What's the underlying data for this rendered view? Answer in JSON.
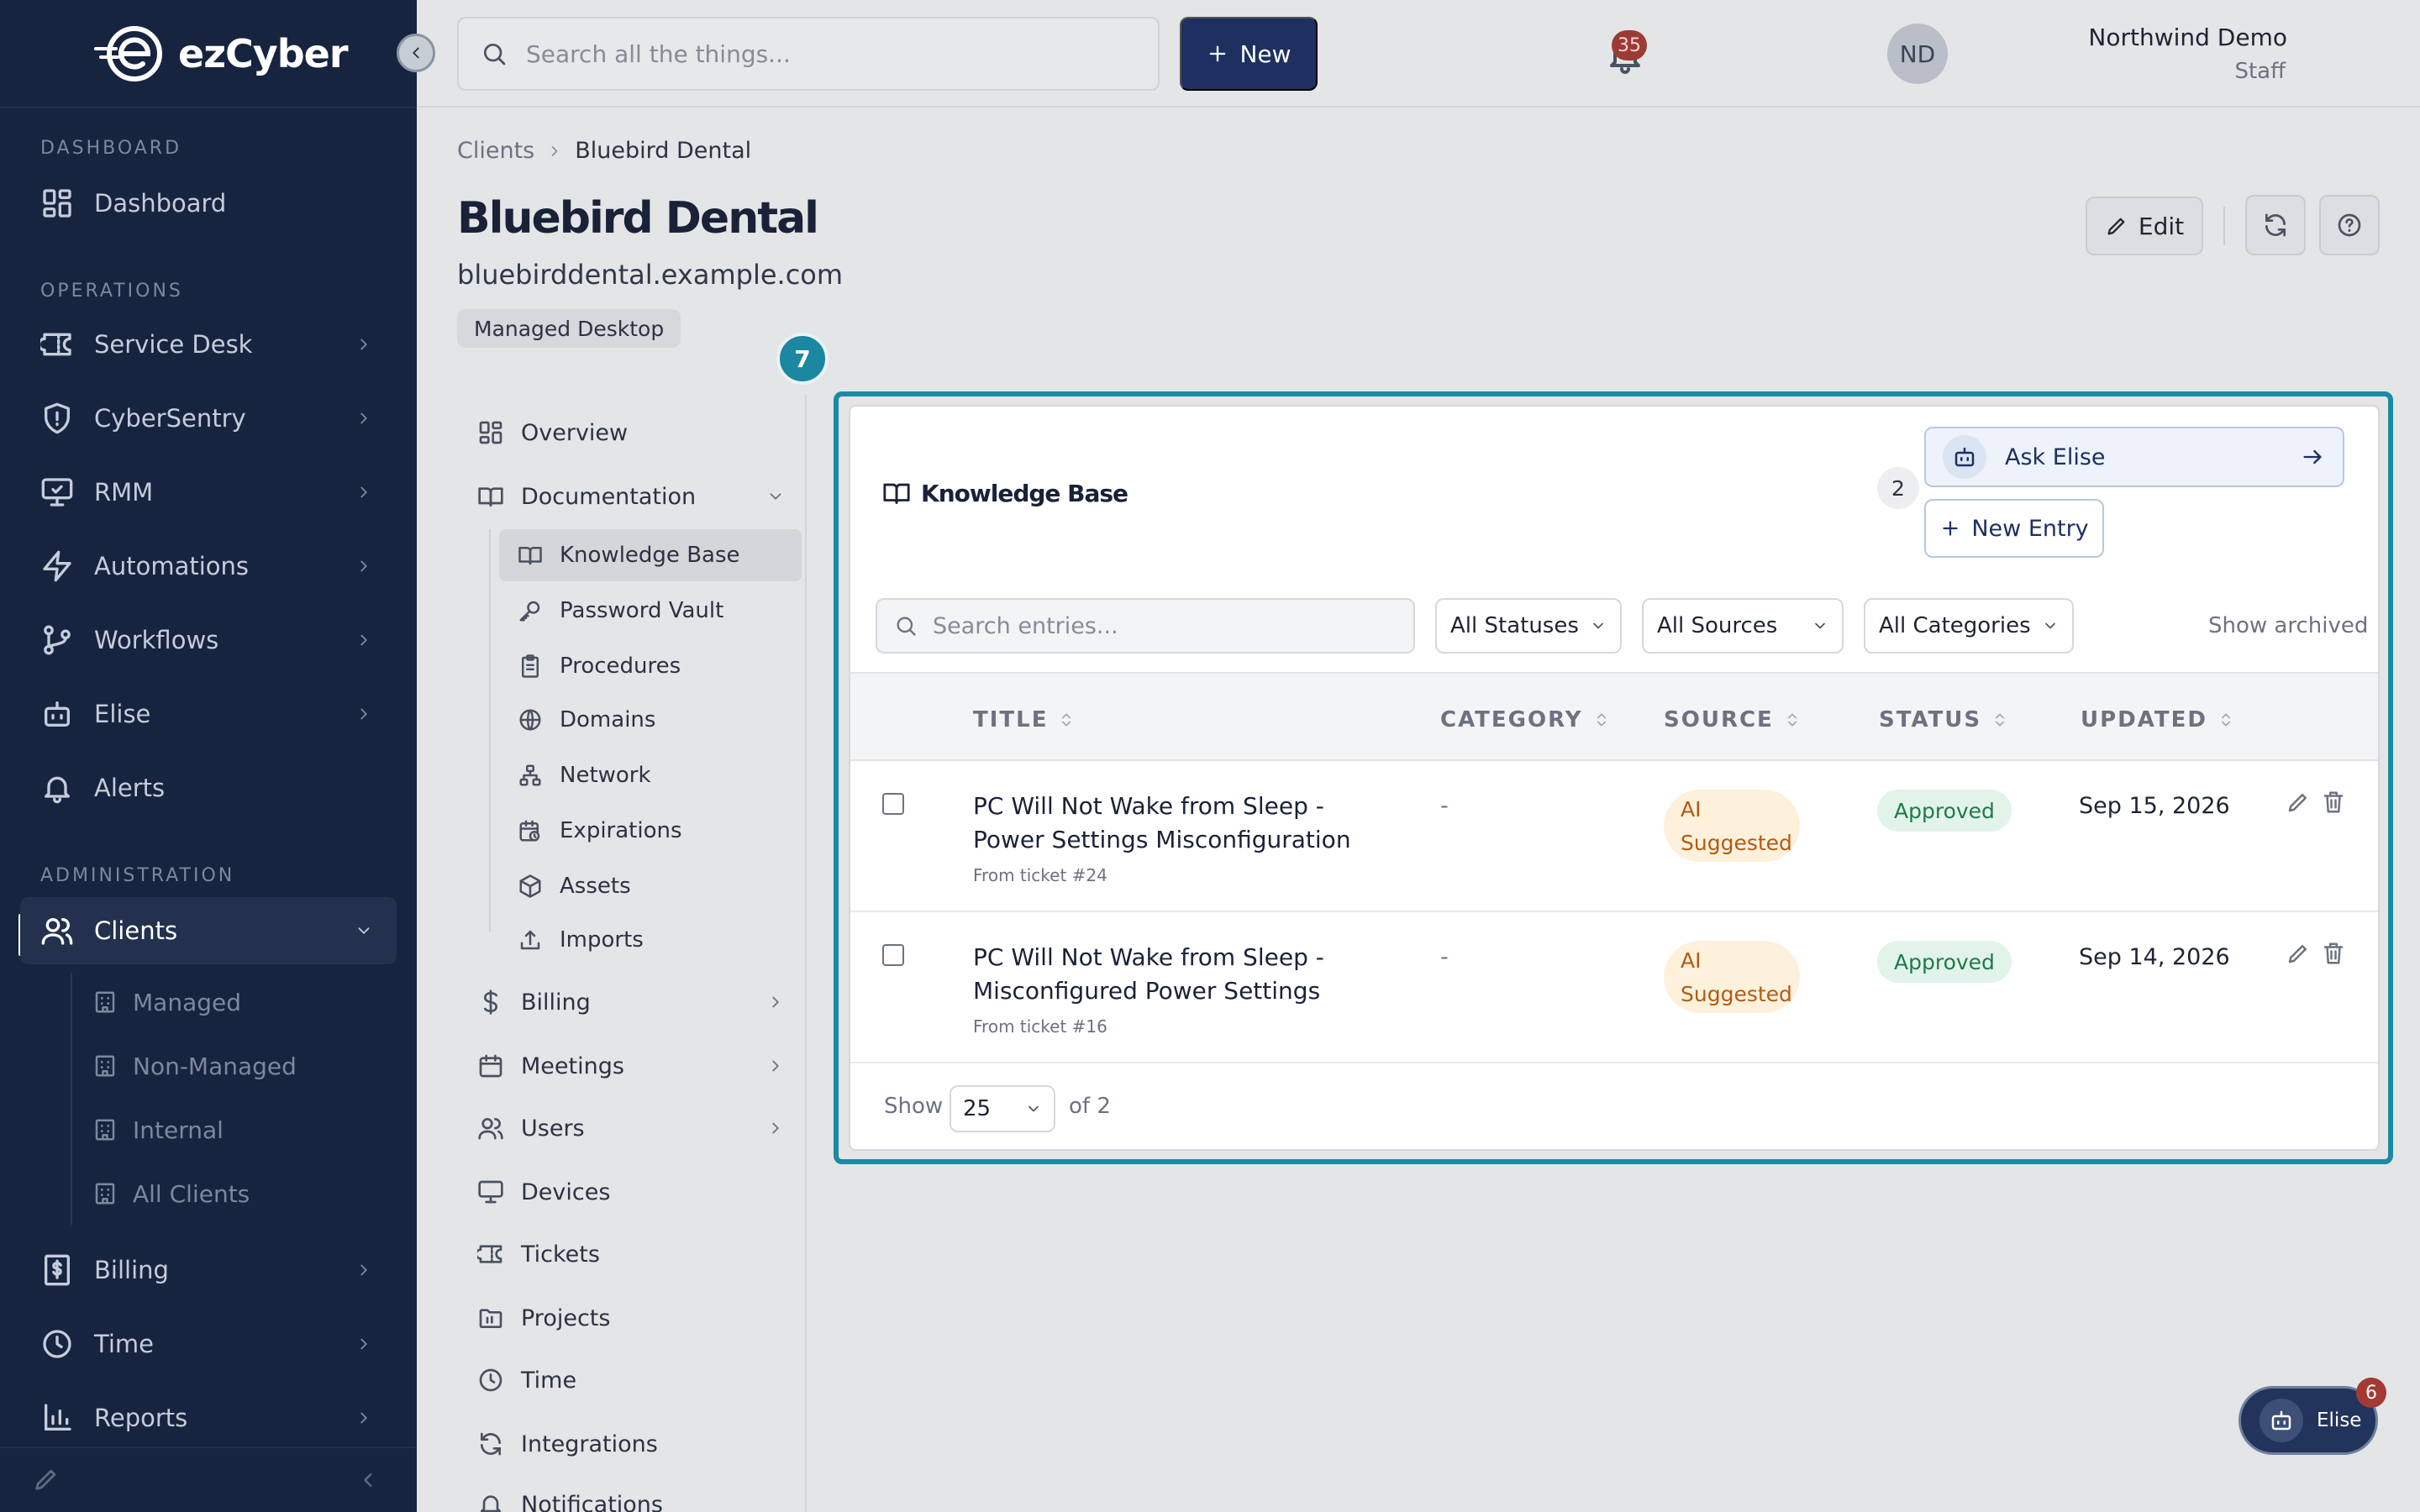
{
  "app": {
    "logo_text": "ezCyber"
  },
  "sidebar": {
    "sections": {
      "dashboard": "DASHBOARD",
      "operations": "OPERATIONS",
      "administration": "ADMINISTRATION"
    },
    "items": {
      "dashboard": "Dashboard",
      "service_desk": "Service Desk",
      "cybersentry": "CyberSentry",
      "rmm": "RMM",
      "automations": "Automations",
      "workflows": "Workflows",
      "elise": "Elise",
      "alerts": "Alerts",
      "clients": "Clients",
      "billing": "Billing",
      "time": "Time",
      "reports": "Reports"
    },
    "client_subitems": [
      "Managed",
      "Non-Managed",
      "Internal",
      "All Clients"
    ]
  },
  "topbar": {
    "search_placeholder": "Search all the things...",
    "new_label": "New",
    "notification_count": "35",
    "user_name": "Northwind Demo",
    "user_role": "Staff",
    "user_initials": "ND"
  },
  "page": {
    "breadcrumb": [
      "Clients",
      "Bluebird Dental"
    ],
    "title": "Bluebird Dental",
    "domain": "bluebirddental.example.com",
    "badge": "Managed Desktop",
    "edit_label": "Edit"
  },
  "subnav": {
    "overview": "Overview",
    "documentation": "Documentation",
    "doc_items": [
      "Knowledge Base",
      "Password Vault",
      "Procedures",
      "Domains",
      "Network",
      "Expirations",
      "Assets",
      "Imports"
    ],
    "billing": "Billing",
    "meetings": "Meetings",
    "users": "Users",
    "devices": "Devices",
    "tickets": "Tickets",
    "projects": "Projects",
    "time": "Time",
    "integrations": "Integrations",
    "notifications": "Notifications"
  },
  "tour": {
    "step": "7",
    "accent": "#1b8aa4"
  },
  "knowledge_base": {
    "title": "Knowledge Base",
    "count": "2",
    "ask_elise_label": "Ask Elise",
    "new_entry_label": "New Entry",
    "search_placeholder": "Search entries...",
    "filters": {
      "status": "All Statuses",
      "source": "All Sources",
      "category": "All Categories"
    },
    "show_archived": "Show archived",
    "columns": [
      "TITLE",
      "CATEGORY",
      "SOURCE",
      "STATUS",
      "UPDATED"
    ],
    "rows": [
      {
        "title": "PC Will Not Wake from Sleep - Power Settings Misconfiguration",
        "from": "From ticket #24",
        "category": "-",
        "source": "AI Suggested",
        "status": "Approved",
        "updated": "Sep 15, 2026"
      },
      {
        "title": "PC Will Not Wake from Sleep - Misconfigured Power Settings",
        "from": "From ticket #16",
        "category": "-",
        "source": "AI Suggested",
        "status": "Approved",
        "updated": "Sep 14, 2026"
      }
    ],
    "footer": {
      "show_label": "Show",
      "page_size": "25",
      "total": "of 2"
    }
  },
  "elise_fab": {
    "label": "Elise",
    "badge": "6"
  }
}
